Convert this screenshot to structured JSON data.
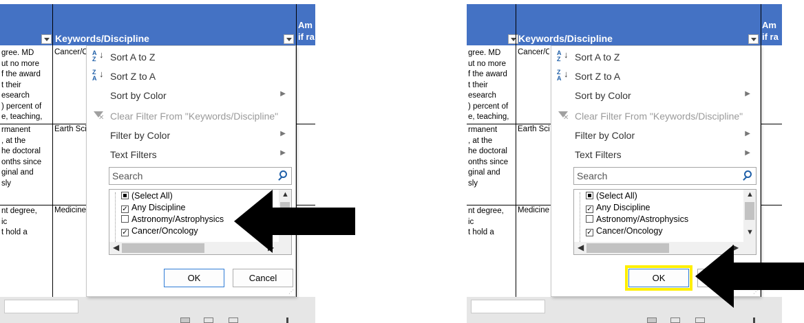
{
  "header": {
    "keywords_label": "Keywords/Discipline",
    "amount_label": "Am\nif ra"
  },
  "rows": [
    {
      "col_a": "gree. MD\nut no more\nf the award\nt their\nesearch\n) percent of\ne, teaching,",
      "col_b": "Cancer/O"
    },
    {
      "col_a": "rmanent\n, at the\nhe doctoral\nonths since\nginal and\nsly",
      "col_b": "Earth Sci"
    },
    {
      "col_a": "nt degree,\nic\nt hold a",
      "col_b": "Medicine"
    }
  ],
  "menu": {
    "sort_az": "Sort A to Z",
    "sort_za": "Sort Z to A",
    "sort_color": "Sort by Color",
    "clear_filter": "Clear Filter From \"Keywords/Discipline\"",
    "filter_color": "Filter by Color",
    "text_filters": "Text Filters",
    "search_placeholder": "Search",
    "ok_label": "OK",
    "cancel_label": "Cancel"
  },
  "filter_list": [
    {
      "label": "(Select All)",
      "state": "partial"
    },
    {
      "label": "Any Discipline",
      "state": "checked"
    },
    {
      "label": "Astronomy/Astrophysics",
      "state": "unchecked"
    },
    {
      "label": "Cancer/Oncology",
      "state": "checked"
    }
  ],
  "colors": {
    "header_blue": "#4472c4",
    "highlight": "#ffef00",
    "arrow": "#000000"
  },
  "icons": {
    "sort_az": "sort-ascending-icon",
    "sort_za": "sort-descending-icon",
    "clear_filter": "clear-filter-icon",
    "search": "search-icon",
    "annotation": "pointer-arrow-icon"
  }
}
